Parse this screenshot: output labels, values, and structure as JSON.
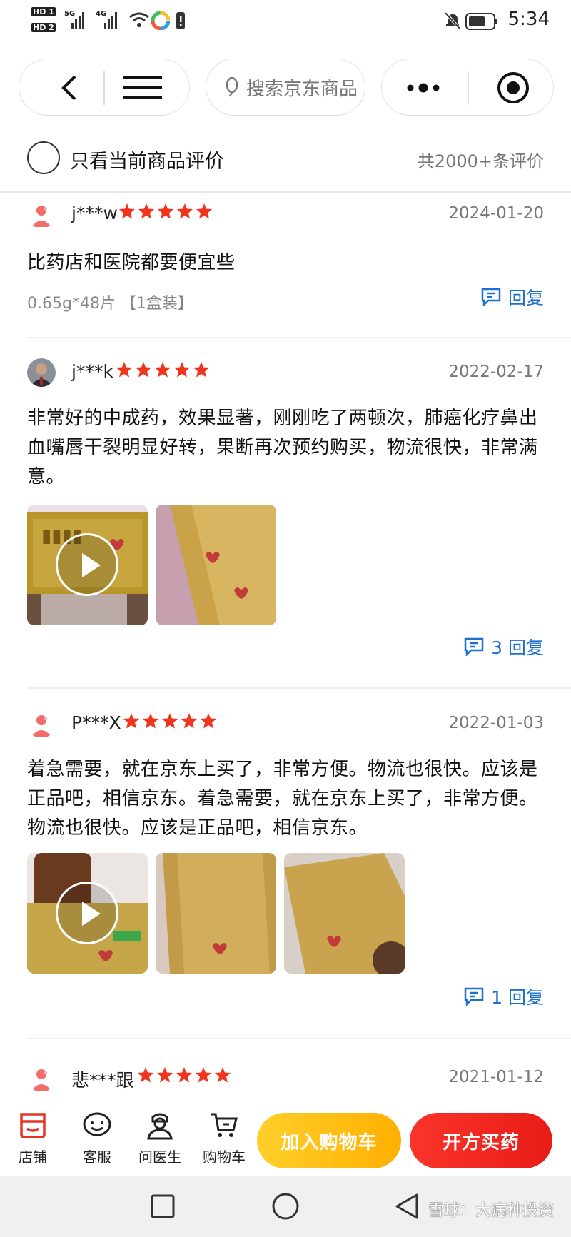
{
  "status_bar": {
    "hd1": "HD 1",
    "hd2": "HD 2",
    "net1": "5G",
    "net2": "4G",
    "time": "5:34"
  },
  "search": {
    "placeholder": "搜索京东商品"
  },
  "filter": {
    "label": "只看当前商品评价",
    "count": "共2000+条评价"
  },
  "reviews": [
    {
      "user": "j***w",
      "rating": 5,
      "date": "2024-01-20",
      "text": "比药店和医院都要便宜些",
      "spec": "0.65g*48片 【1盒装】",
      "reply_label": "回复"
    },
    {
      "user": "j***k",
      "rating": 5,
      "date": "2022-02-17",
      "text": "非常好的中成药，效果显著，刚刚吃了两顿次，肺癌化疗鼻出血嘴唇干裂明显好转，果断再次预约购买，物流很快，非常满意。",
      "reply_label": "3 回复"
    },
    {
      "user": "P***X",
      "rating": 5,
      "date": "2022-01-03",
      "text": "着急需要，就在京东上买了，非常方便。物流也很快。应该是正品吧，相信京东。着急需要，就在京东上买了，非常方便。物流也很快。应该是正品吧，相信京东。",
      "reply_label": "1 回复"
    },
    {
      "user": "悲***跟",
      "rating": 5,
      "date": "2021-01-12"
    }
  ],
  "bottom_tabs": [
    {
      "label": "店铺",
      "icon": "store-icon"
    },
    {
      "label": "客服",
      "icon": "chat-icon"
    },
    {
      "label": "问医生",
      "icon": "doctor-icon"
    },
    {
      "label": "购物车",
      "icon": "cart-icon"
    }
  ],
  "actions": {
    "add_cart": "加入购物车",
    "prescription_buy": "开方买药"
  },
  "watermark": "雪球：大病种投资",
  "colors": {
    "star": "#f0341d",
    "reply": "#1f6fd1",
    "add_cart": "#ffc01a",
    "buy": "#f0251c",
    "store_tab": "#e83423"
  }
}
